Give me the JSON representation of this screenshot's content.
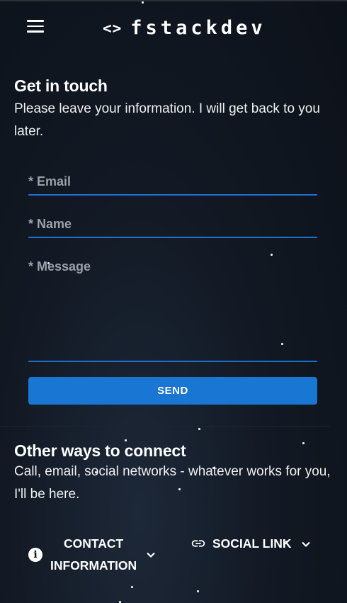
{
  "header": {
    "menu_icon": "hamburger-menu-icon",
    "brand_icon_text": "<>",
    "brand_text": "fstackdev"
  },
  "contact_form": {
    "title": "Get in touch",
    "subtitle": "Please leave your information. I will get back to you later.",
    "email_label": "* Email",
    "name_label": "* Name",
    "message_label": "* Message",
    "send_label": "SEND"
  },
  "other_ways": {
    "title": "Other ways to connect",
    "subtitle": "Call, email, social networks - whatever works for you, I'll be here.",
    "contact_info_label_line1": "CONTACT",
    "contact_info_label_line2": "INFORMATION",
    "social_link_label": "SOCIAL LINK",
    "contact_info_icon": "info-icon",
    "social_link_icon": "link-icon"
  },
  "colors": {
    "accent": "#1976d2",
    "background": "#0f1520",
    "label": "#9aa0a8"
  }
}
